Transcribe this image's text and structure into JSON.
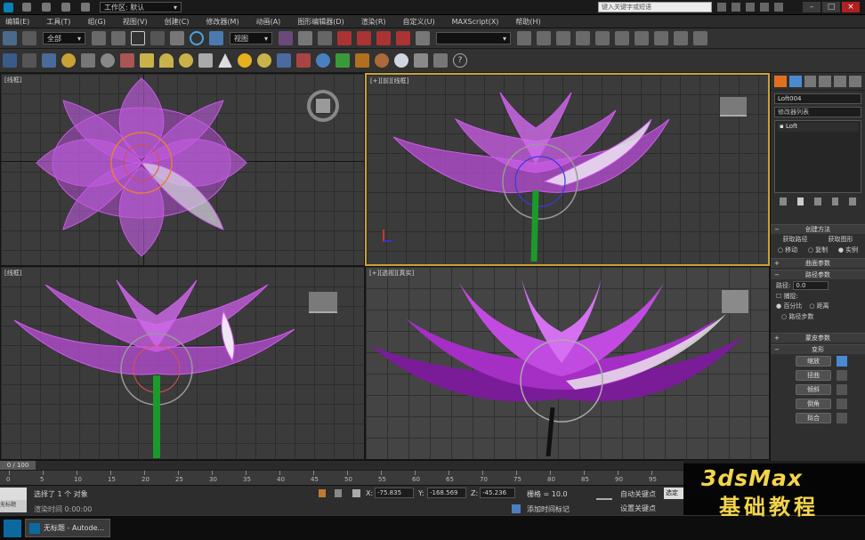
{
  "title_bar": {
    "workspace_label": "工作区: 默认",
    "search_placeholder": "键入关键字或短语"
  },
  "menu": [
    "编辑(E)",
    "工具(T)",
    "组(G)",
    "视图(V)",
    "创建(C)",
    "修改器(M)",
    "动画(A)",
    "图形编辑器(D)",
    "渲染(R)",
    "自定义(U)",
    "MAXScript(X)",
    "帮助(H)"
  ],
  "toolbar": {
    "filter_select": "全部",
    "coord_select": "视图",
    "named_selection": ""
  },
  "viewports": {
    "top_left": {
      "label": "[线框]"
    },
    "top_right": {
      "label": "[+][前][线框]"
    },
    "bottom_left": {
      "label": "[线框]"
    },
    "bottom_right": {
      "label": "[+][透视][真实]"
    }
  },
  "command_panel": {
    "object_name": "Loft004",
    "modifier_list": "修改器列表",
    "stack_item": "Loft",
    "creation_method_title": "创建方法",
    "get_path": "获取路径",
    "get_shape": "获取图形",
    "move": "移动",
    "copy": "复制",
    "instance": "实例",
    "surface_params": "曲面参数",
    "path_params": "路径参数",
    "path_label": "路径:",
    "path_value": "0.0",
    "snap_label": "捕捉:",
    "percent": "百分比",
    "distance": "距离",
    "path_steps": "路径步数",
    "skin_params": "蒙皮参数",
    "deformation": "变形",
    "scale": "缩放",
    "twist": "扭曲",
    "teeter": "倾斜",
    "bevel": "倒角",
    "fit": "拟合"
  },
  "timeline": {
    "frame_counter": "0 / 100",
    "ticks": [
      "0",
      "5",
      "10",
      "15",
      "20",
      "25",
      "30",
      "35",
      "40",
      "45",
      "50",
      "55",
      "60",
      "65",
      "70",
      "75",
      "80",
      "85",
      "90",
      "95"
    ]
  },
  "status": {
    "selection": "选择了 1 个 对象",
    "render_time": "渲染时间 0:00:00",
    "x_label": "X:",
    "x_value": "-75.835",
    "y_label": "Y:",
    "y_value": "-168.569",
    "z_label": "Z:",
    "z_value": "-45.236",
    "grid": "栅格 = 10.0",
    "add_time_tag": "添加时间标记",
    "auto_key": "自动关键点",
    "set_key": "设置关键点",
    "selected": "选定"
  },
  "taskbar": {
    "item1": "无标题",
    "item2": "无标题 - Autode..."
  },
  "banner": {
    "line1": "3dsMax",
    "line2": "基础教程"
  },
  "colors": {
    "accent": "#c9a235",
    "flower": "#c43ce0",
    "stem": "#1a9a2a"
  }
}
